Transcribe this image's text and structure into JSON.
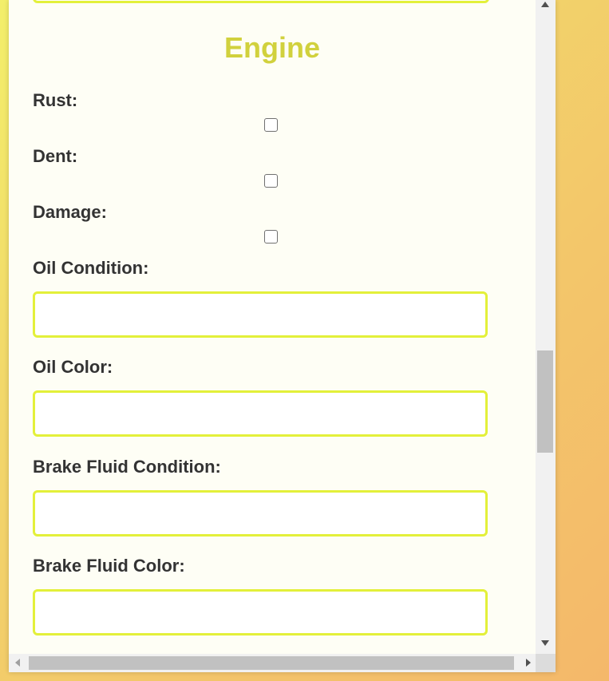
{
  "section": {
    "title": "Engine"
  },
  "fields": {
    "rust": {
      "label": "Rust:",
      "checked": false
    },
    "dent": {
      "label": "Dent:",
      "checked": false
    },
    "damage": {
      "label": "Damage:",
      "checked": false
    },
    "oil_condition": {
      "label": "Oil Condition:",
      "value": ""
    },
    "oil_color": {
      "label": "Oil Color:",
      "value": ""
    },
    "brake_fluid_condition": {
      "label": "Brake Fluid Condition:",
      "value": ""
    },
    "brake_fluid_color": {
      "label": "Brake Fluid Color:",
      "value": ""
    }
  },
  "colors": {
    "accent_border": "#e3f03a",
    "title": "#d1d13d",
    "label_text": "#333333",
    "panel_background": "#fefef5"
  },
  "icons": {
    "scroll_up": "triangle-up",
    "scroll_down": "triangle-down",
    "scroll_left": "triangle-left",
    "scroll_right": "triangle-right"
  }
}
